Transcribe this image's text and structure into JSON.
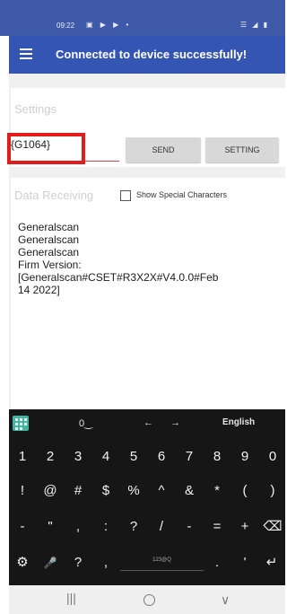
{
  "status_bar": {
    "time": "09:22",
    "notifications": "▣ ▶ ▶ •",
    "system_icons": "☰ ◢ ▮"
  },
  "app_bar": {
    "title": "Connected to device successfully!"
  },
  "settings": {
    "label": "Settings",
    "command_value": "{G1064}",
    "send_label": "SEND",
    "setting_label": "SETTING"
  },
  "receiving": {
    "label": "Data Receiving",
    "special_chars_label": "Show Special Characters",
    "lines": [
      "Generalscan",
      "Generalscan",
      "Generalscan",
      "Firm Version:",
      "[Generalscan#CSET#R3X2X#V4.0.0#Feb",
      "14 2022]"
    ]
  },
  "keyboard": {
    "top_row": {
      "emoji": "0‿",
      "left_arrow": "←",
      "right_arrow": "→",
      "language": "English"
    },
    "rows": [
      [
        "1",
        "2",
        "3",
        "4",
        "5",
        "6",
        "7",
        "8",
        "9",
        "0"
      ],
      [
        "!",
        "@",
        "#",
        "$",
        "%",
        "^",
        "&",
        "*",
        "(",
        ")"
      ],
      [
        "-",
        "\"",
        ",",
        ":",
        "?",
        "/",
        "-",
        "=",
        "+",
        "⌫"
      ],
      [
        "⚙",
        "🎤",
        "?",
        ",",
        "",
        "",
        "",
        ".",
        "'",
        "↵"
      ]
    ],
    "space_label": "123@Q"
  },
  "nav_bar": {
    "recent": "|||",
    "home": "",
    "back": "∨"
  },
  "colors": {
    "status_bar": "#3f5aa8",
    "app_bar": "#3555b3",
    "highlight": "#e21b1b",
    "keyboard_bg": "#161616",
    "grid_icon": "#47b3a3"
  }
}
